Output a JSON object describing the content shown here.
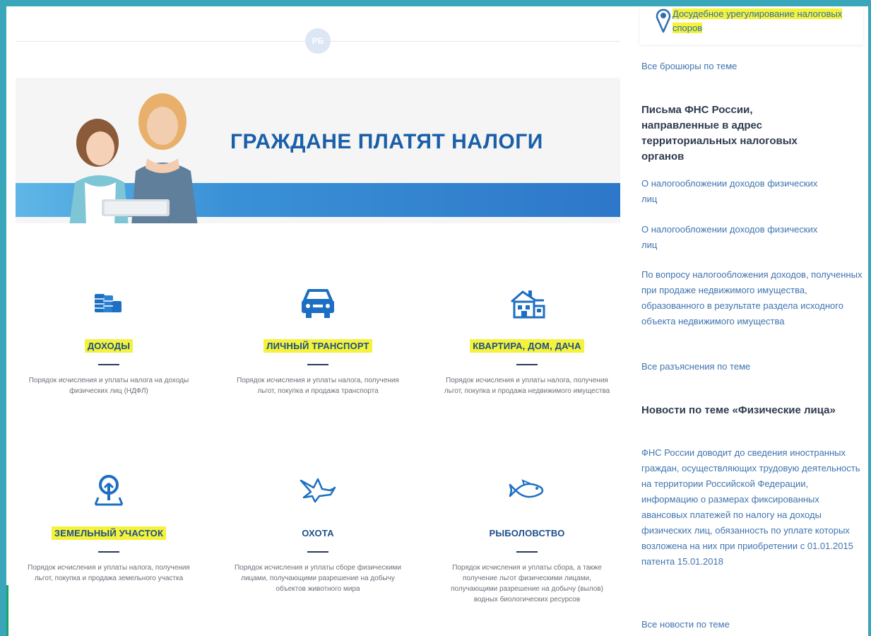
{
  "top_badge": "РБ",
  "banner": {
    "title": "ГРАЖДАНЕ ПЛАТЯТ НАЛОГИ"
  },
  "categories": [
    {
      "icon": "coins-icon",
      "title": "ДОХОДЫ",
      "highlighted": true,
      "desc": "Порядок исчисления и уплаты налога на доходы физических лиц (НДФЛ)"
    },
    {
      "icon": "car-icon",
      "title": "ЛИЧНЫЙ ТРАНСПОРТ",
      "highlighted": true,
      "desc": "Порядок исчисления и уплаты налога, получения льгот, покупка и продажа транспорта"
    },
    {
      "icon": "house-icon",
      "title": "КВАРТИРА, ДОМ, ДАЧА",
      "highlighted": true,
      "desc": "Порядок исчисления и уплаты налога, получения льгот, покупка и продажа недвижимого имущества"
    },
    {
      "icon": "land-plot-icon",
      "title": "ЗЕМЕЛЬНЫЙ УЧАСТОК",
      "highlighted": true,
      "desc": "Порядок исчисления и уплаты налога, получения льгот, покупка и продажа земельного участка"
    },
    {
      "icon": "bird-icon",
      "title": "ОХОТА",
      "highlighted": false,
      "desc": "Порядок исчисления и уплаты сборе физическими лицами, получающими разрешение на добычу объектов животного мира"
    },
    {
      "icon": "fish-icon",
      "title": "РЫБОЛОВСТВО",
      "highlighted": false,
      "desc": "Порядок исчисления и уплаты сбора, а также получение льгот физическими лицами, получающими разрешение на добычу (вылов) водных биологических ресурсов"
    }
  ],
  "sidebar": {
    "brochure_title": "Досудебное урегулирование налоговых споров",
    "all_brochures": "Все брошюры по теме",
    "letters_heading": "Письма ФНС России, направленные в адрес территориальных налоговых органов",
    "letters": [
      "О налогообложении доходов физических лиц",
      "О налогообложении доходов физических лиц",
      "По вопросу налогообложения доходов, полученных при продаже недвижимого имущества, образованного в результате раздела исходного объекта недвижимого имущества"
    ],
    "all_explanations": "Все разъяснения по теме",
    "news_heading": "Новости по теме «Физические лица»",
    "news_text": "ФНС России доводит до сведения иностранных граждан, осуществляющих трудовую деятельность на территории Российской Федерации, информацию о размерах фиксированных авансовых платежей по налогу на доходы физических лиц, обязанность по уплате которых возложена на них при приобретении с 01.01.2015 патента",
    "news_date": "15.01.2018",
    "all_news": "Все новости по теме"
  },
  "colors": {
    "frame": "#3aa6b9",
    "accent": "#1a5fa8",
    "link": "#3f74b0",
    "highlight": "#f4f23a"
  }
}
